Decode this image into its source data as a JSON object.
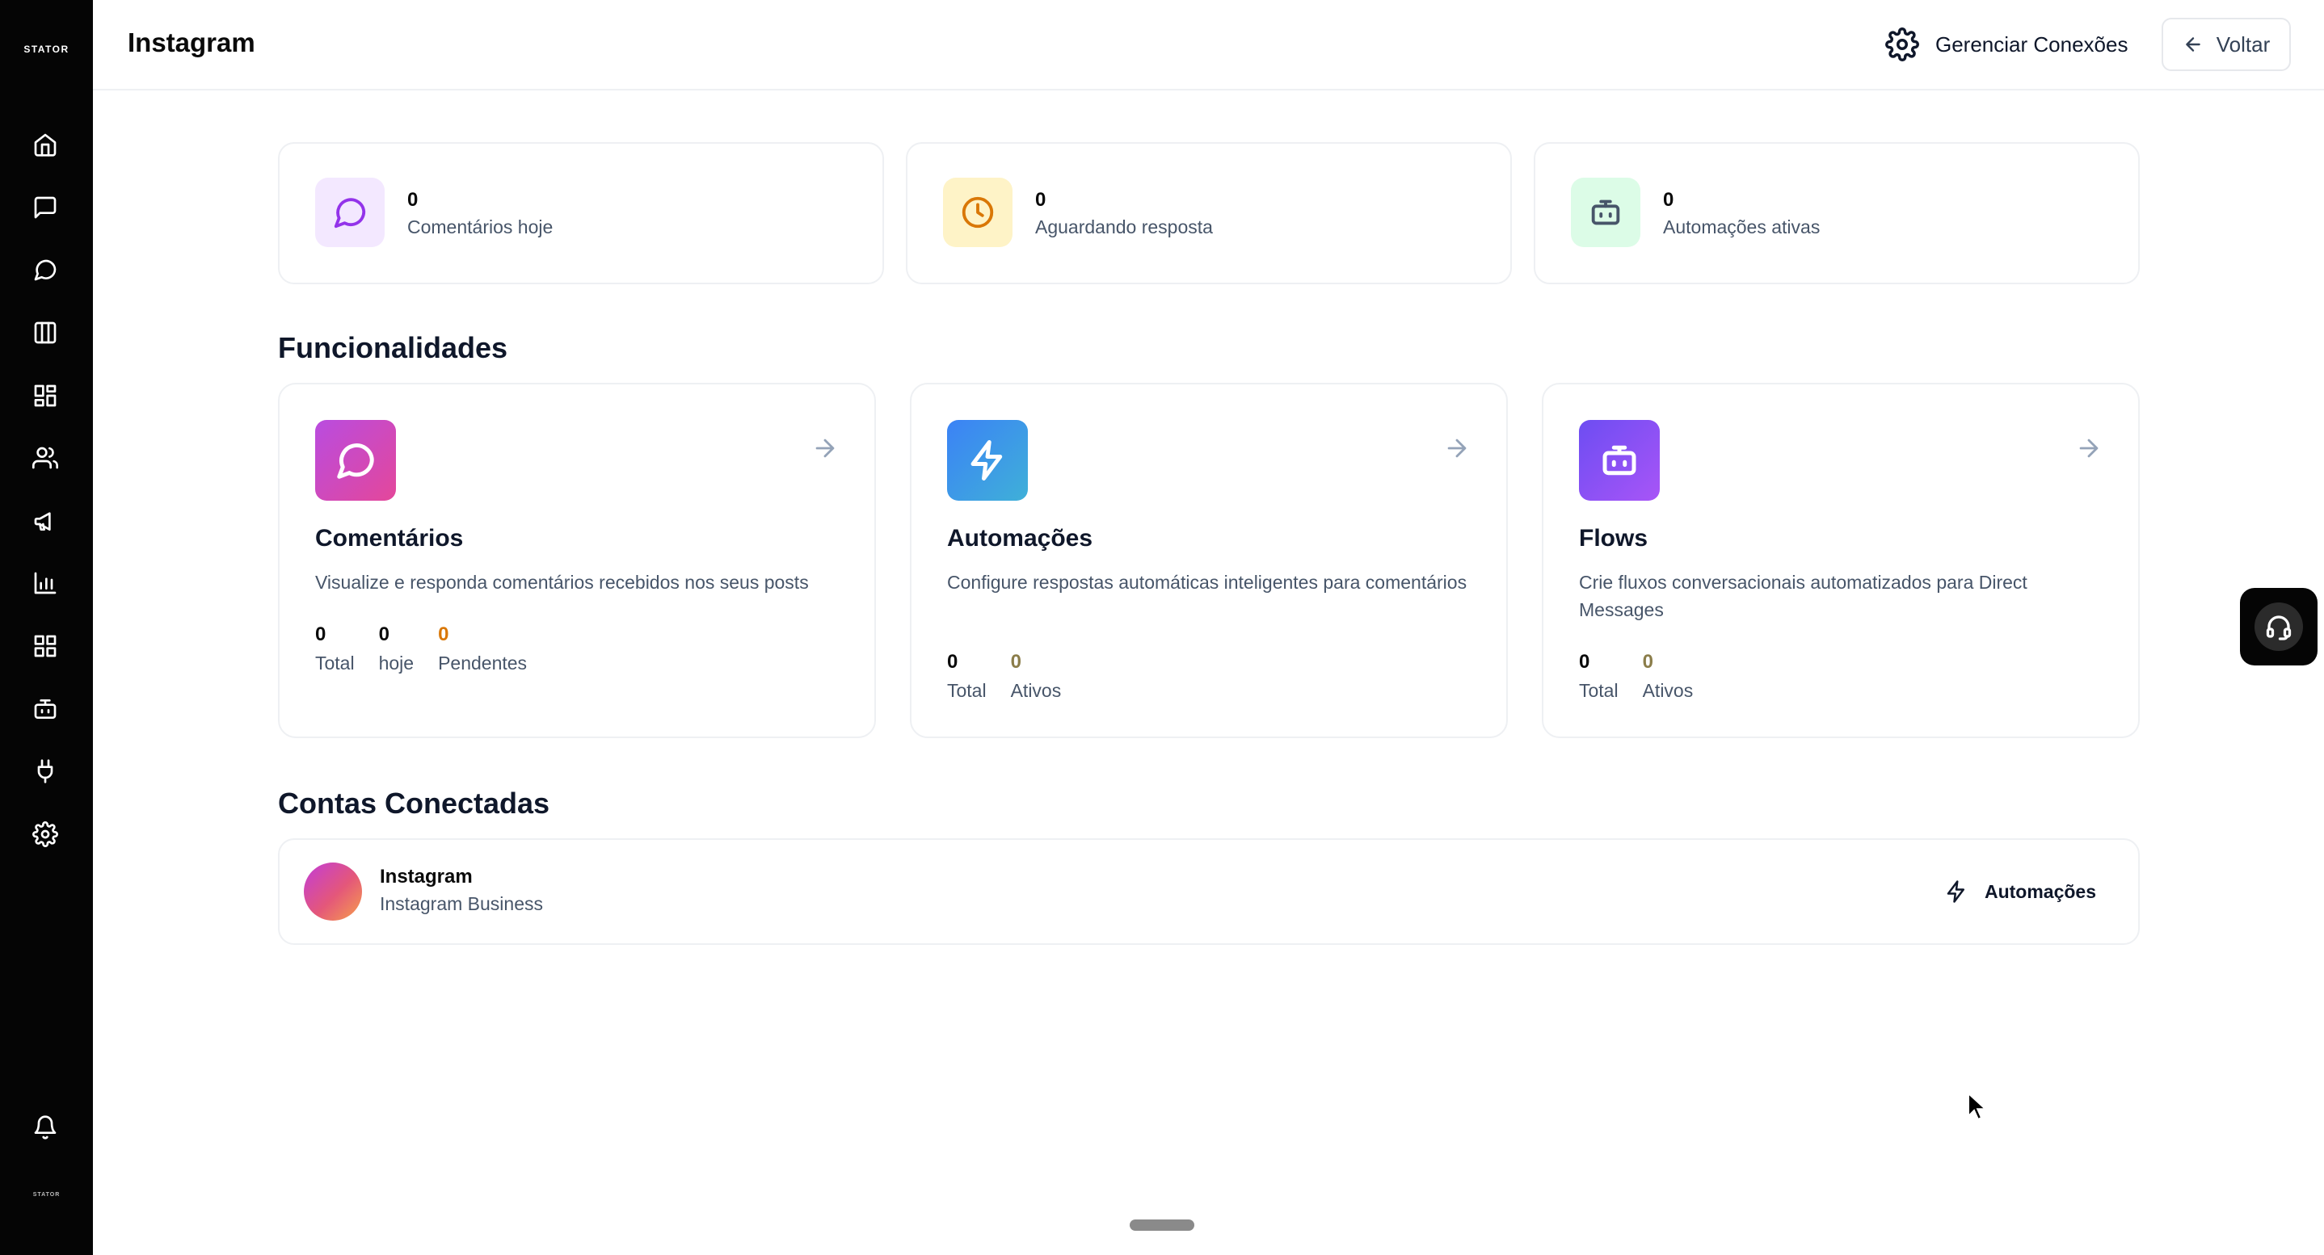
{
  "sidebar": {
    "brand": "STATOR",
    "brand_small": "STATOR",
    "items": [
      {
        "icon": "home-icon"
      },
      {
        "icon": "message-square-icon"
      },
      {
        "icon": "message-circle-icon"
      },
      {
        "icon": "kanban-icon"
      },
      {
        "icon": "layout-grid-icon"
      },
      {
        "icon": "users-icon"
      },
      {
        "icon": "megaphone-icon"
      },
      {
        "icon": "bar-chart-icon"
      },
      {
        "icon": "apps-grid-icon"
      },
      {
        "icon": "bot-icon"
      },
      {
        "icon": "plug-icon"
      },
      {
        "icon": "settings-icon"
      }
    ],
    "footer": {
      "icon": "bell-icon"
    }
  },
  "header": {
    "title": "Instagram",
    "manage_label": "Gerenciar Conexões",
    "back_label": "Voltar"
  },
  "stats": [
    {
      "value": "0",
      "label": "Comentários hoje",
      "icon": "message-circle-icon",
      "color": "#9333ea",
      "bg": "#f3e8ff"
    },
    {
      "value": "0",
      "label": "Aguardando resposta",
      "icon": "clock-icon",
      "color": "#d97706",
      "bg": "#fef3c7"
    },
    {
      "value": "0",
      "label": "Automações ativas",
      "icon": "bot-icon",
      "color": "#475569",
      "bg": "#dcfce7"
    }
  ],
  "features_title": "Funcionalidades",
  "features": [
    {
      "title": "Comentários",
      "description": "Visualize e responda comentários recebidos nos seus posts",
      "icon": "message-circle-icon",
      "metrics": [
        {
          "value": "0",
          "label": "Total"
        },
        {
          "value": "0",
          "label": "hoje"
        },
        {
          "value": "0",
          "label": "Pendentes"
        }
      ]
    },
    {
      "title": "Automações",
      "description": "Configure respostas automáticas inteligentes para comentários",
      "icon": "zap-icon",
      "metrics": [
        {
          "value": "0",
          "label": "Total"
        },
        {
          "value": "0",
          "label": "Ativos"
        }
      ]
    },
    {
      "title": "Flows",
      "description": "Crie fluxos conversacionais automatizados para Direct Messages",
      "icon": "bot-icon",
      "metrics": [
        {
          "value": "0",
          "label": "Total"
        },
        {
          "value": "0",
          "label": "Ativos"
        }
      ]
    }
  ],
  "accounts_title": "Contas Conectadas",
  "accounts": [
    {
      "name": "Instagram",
      "type": "Instagram Business",
      "action_label": "Automações"
    }
  ]
}
